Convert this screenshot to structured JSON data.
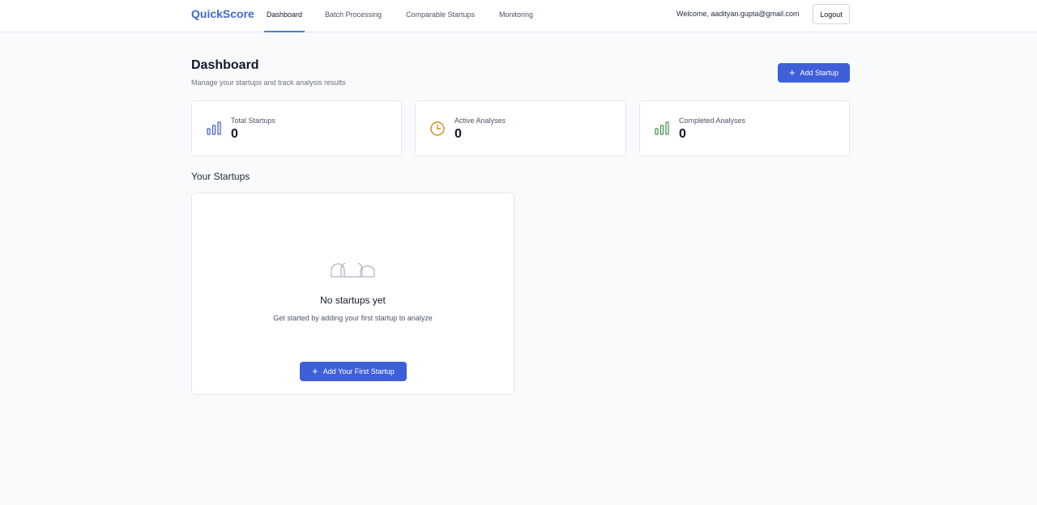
{
  "app": {
    "brand": "QuickScore"
  },
  "nav": {
    "tabs": [
      {
        "label": "Dashboard",
        "active": true
      },
      {
        "label": "Batch Processing",
        "active": false
      },
      {
        "label": "Comparable Startups",
        "active": false
      },
      {
        "label": "Monitoring",
        "active": false
      }
    ],
    "welcome": "Welcome, aadityan.gupta@gmail.com",
    "logout_label": "Logout"
  },
  "header": {
    "title": "Dashboard",
    "subtitle": "Manage your startups and track analysis results",
    "add_button_label": "Add Startup"
  },
  "stats": [
    {
      "label": "Total Startups",
      "value": "0",
      "icon": "bar-chart-icon",
      "color": "#3b5bc4"
    },
    {
      "label": "Active Analyses",
      "value": "0",
      "icon": "clock-icon",
      "color": "#c8931a"
    },
    {
      "label": "Completed Analyses",
      "value": "0",
      "icon": "bar-chart-icon",
      "color": "#3f8f47"
    }
  ],
  "startups": {
    "section_title": "Your Startups",
    "empty_title": "No startups yet",
    "empty_text": "Get started by adding your first startup to analyze",
    "add_first_label": "Add Your First Startup",
    "empty_icon": "building-icon"
  },
  "colors": {
    "brand": "#4168c8",
    "primary_button": "#3f5fd8",
    "background": "#f8fafc"
  }
}
